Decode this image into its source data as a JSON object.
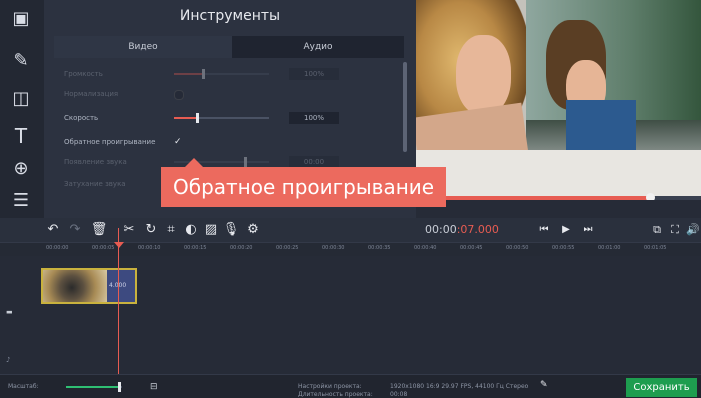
{
  "tools_panel": {
    "title": "Инструменты",
    "tabs": [
      "Видео",
      "Аудио"
    ],
    "rows": [
      {
        "label": "Громкость",
        "value": "100%"
      },
      {
        "label": "Нормализация",
        "value": ""
      },
      {
        "label": "Скорость",
        "value": "100%"
      },
      {
        "label": "Обратное проигрывание",
        "value": ""
      },
      {
        "label": "Появление звука",
        "value": "00:00"
      },
      {
        "label": "Затухание звука",
        "value": ""
      }
    ]
  },
  "callout": {
    "text": "Обратное проигрывание"
  },
  "timeline": {
    "timecode_main": "00:00",
    "timecode_frac": ":07.000",
    "ruler": [
      "00:00:00",
      "00:00:05",
      "00:00:10",
      "00:00:15",
      "00:00:20",
      "00:00:25",
      "00:00:30",
      "00:00:35",
      "00:00:40",
      "00:00:45",
      "00:00:50",
      "00:00:55",
      "00:01:00",
      "00:01:05"
    ],
    "clip_label": "4.000"
  },
  "bottom": {
    "zoom_label": "Масштаб:",
    "project_settings_label": "Настройки проекта:",
    "project_settings_value": "1920x1080 16:9 29.97 FPS, 44100 Гц Стерео",
    "duration_label": "Длительность проекта:",
    "duration_value": "00:08",
    "save_label": "Сохранить"
  },
  "colors": {
    "accent": "#e75c52",
    "save": "#1e9d4f",
    "clip_border": "#c9b23e"
  }
}
